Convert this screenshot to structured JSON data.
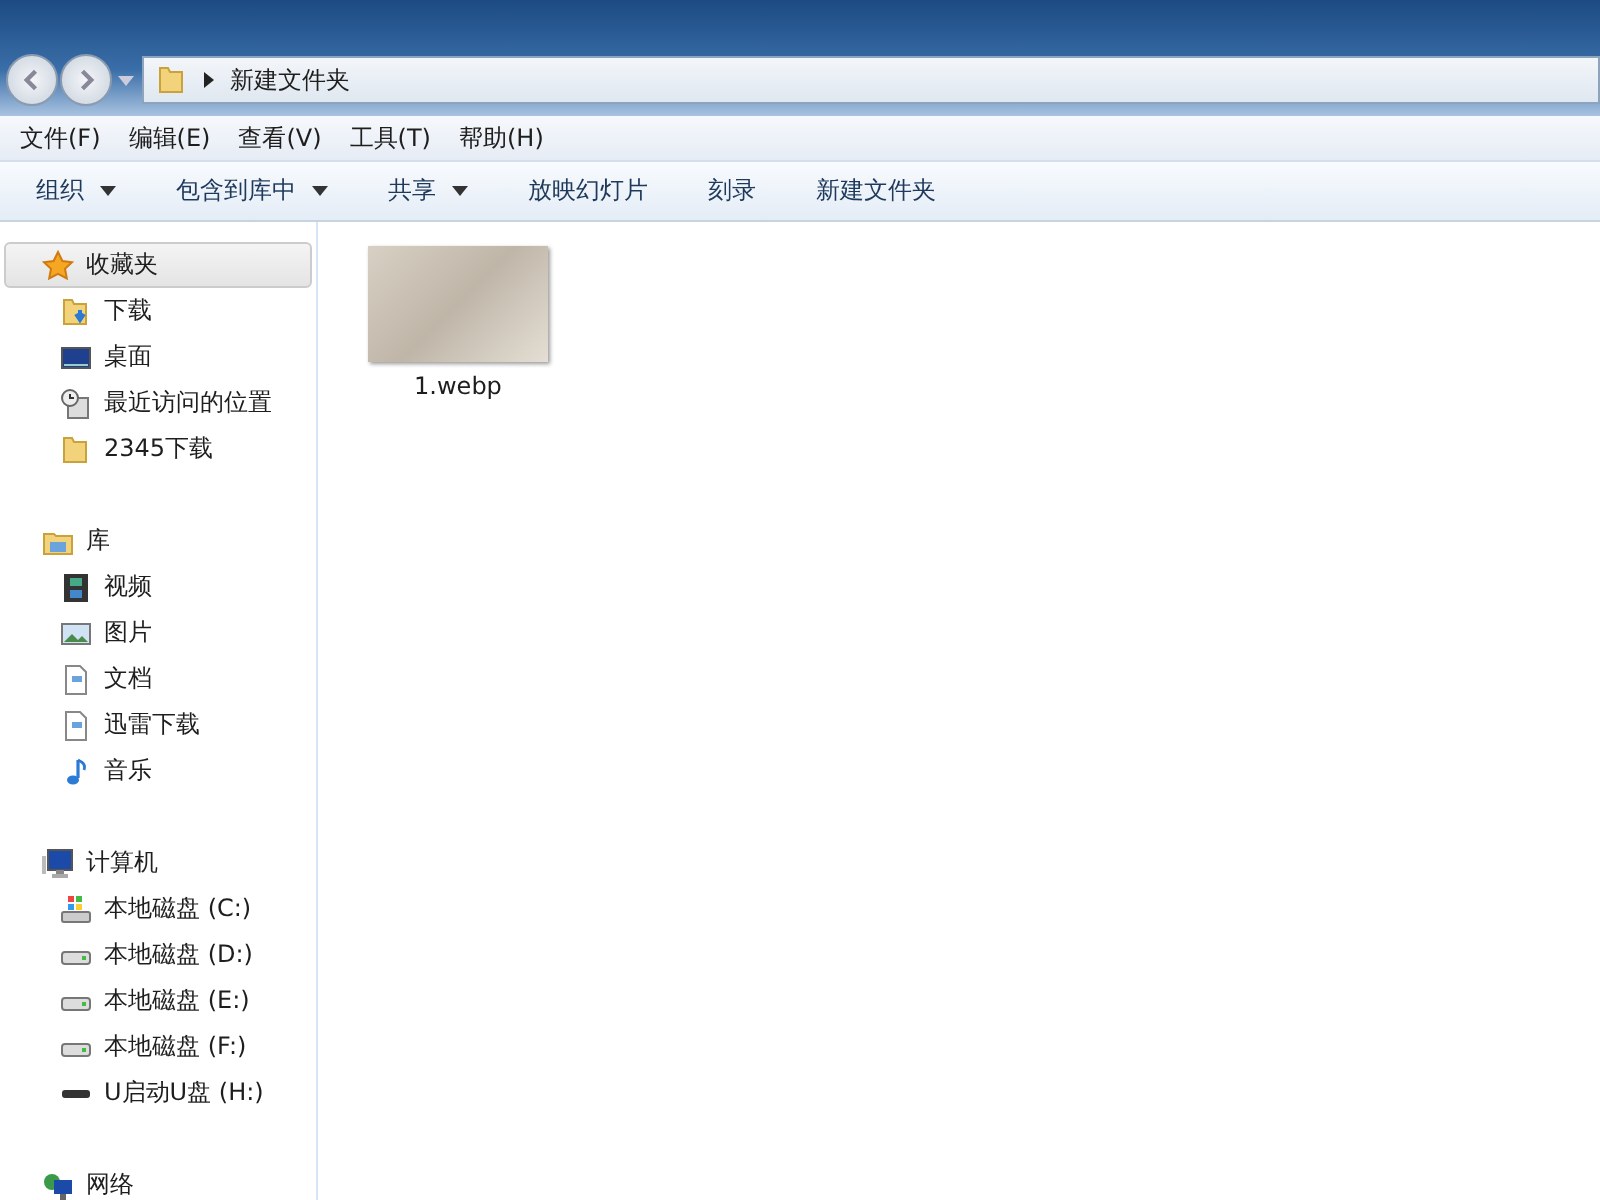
{
  "address_bar": {
    "path": "新建文件夹"
  },
  "menu_bar": [
    "文件(F)",
    "编辑(E)",
    "查看(V)",
    "工具(T)",
    "帮助(H)"
  ],
  "toolbar": [
    {
      "label": "组织",
      "dropdown": true
    },
    {
      "label": "包含到库中",
      "dropdown": true
    },
    {
      "label": "共享",
      "dropdown": true
    },
    {
      "label": "放映幻灯片",
      "dropdown": false
    },
    {
      "label": "刻录",
      "dropdown": false
    },
    {
      "label": "新建文件夹",
      "dropdown": false
    }
  ],
  "sidebar": {
    "groups": [
      {
        "label": "收藏夹",
        "kind": "star",
        "selected": true,
        "children": [
          {
            "label": "下载",
            "kind": "download"
          },
          {
            "label": "桌面",
            "kind": "desktop"
          },
          {
            "label": "最近访问的位置",
            "kind": "recent"
          },
          {
            "label": "2345下载",
            "kind": "folder"
          }
        ]
      },
      {
        "label": "库",
        "kind": "library",
        "selected": false,
        "children": [
          {
            "label": "视频",
            "kind": "video"
          },
          {
            "label": "图片",
            "kind": "picture"
          },
          {
            "label": "文档",
            "kind": "document"
          },
          {
            "label": "迅雷下载",
            "kind": "document"
          },
          {
            "label": "音乐",
            "kind": "music"
          }
        ]
      },
      {
        "label": "计算机",
        "kind": "computer",
        "selected": false,
        "children": [
          {
            "label": "本地磁盘 (C:)",
            "kind": "system-drive"
          },
          {
            "label": "本地磁盘 (D:)",
            "kind": "drive"
          },
          {
            "label": "本地磁盘 (E:)",
            "kind": "drive"
          },
          {
            "label": "本地磁盘 (F:)",
            "kind": "drive"
          },
          {
            "label": "U启动U盘 (H:)",
            "kind": "usb"
          }
        ]
      },
      {
        "label": "网络",
        "kind": "network",
        "selected": false
      }
    ]
  },
  "files": [
    {
      "name": "1.webp"
    }
  ]
}
